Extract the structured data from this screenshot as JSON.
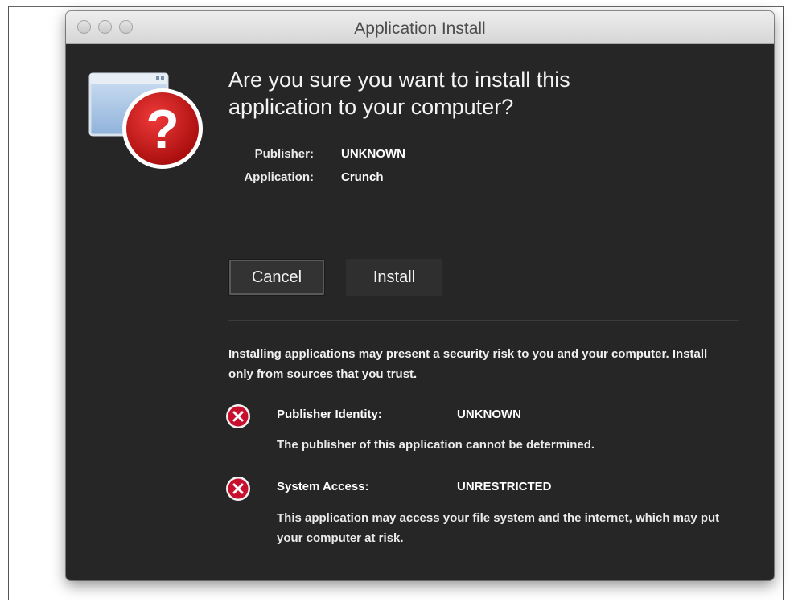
{
  "window": {
    "title": "Application Install"
  },
  "dialog": {
    "headline_line1": "Are you sure you want to install this",
    "headline_line2": "application to your computer?",
    "publisher_label": "Publisher:",
    "publisher_value": "UNKNOWN",
    "application_label": "Application:",
    "application_value": "Crunch"
  },
  "buttons": {
    "cancel": "Cancel",
    "install": "Install"
  },
  "warning": {
    "text": "Installing applications may present a security risk to you and your computer. Install only from sources that you trust."
  },
  "risks": [
    {
      "label": "Publisher Identity:",
      "value": "UNKNOWN",
      "description": "The publisher of this application cannot be determined."
    },
    {
      "label": "System Access:",
      "value": "UNRESTRICTED",
      "description": "This application may access your file system and the internet, which may put your computer at risk."
    }
  ],
  "icons": {
    "app_question": "question-warning-icon",
    "risk_error": "error-x-icon"
  },
  "colors": {
    "window_bg": "#262626",
    "error_red": "#c8102e"
  }
}
